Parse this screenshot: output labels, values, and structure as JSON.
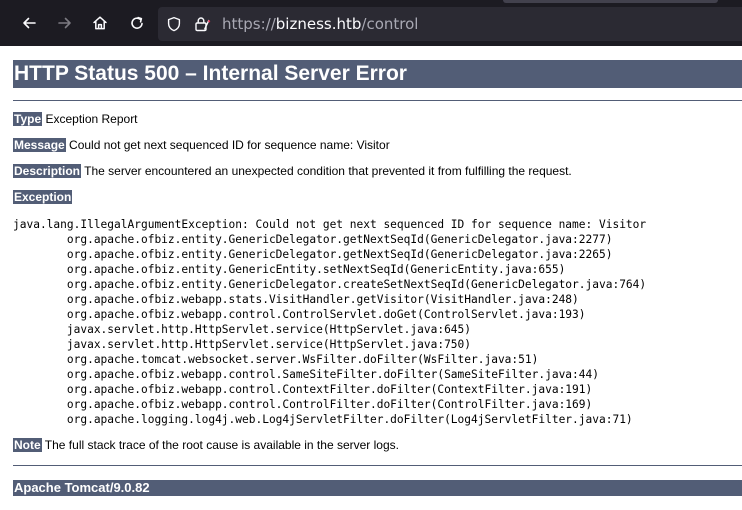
{
  "browser": {
    "url_scheme": "https://",
    "url_host": "bizness.htb",
    "url_path": "/control",
    "icons": [
      "back-arrow-icon",
      "forward-arrow-icon",
      "home-icon",
      "reload-icon",
      "shield-icon",
      "lock-icon"
    ]
  },
  "page": {
    "title": "HTTP Status 500 – Internal Server Error",
    "type_label": "Type",
    "type_value": "Exception Report",
    "message_label": "Message",
    "message_value": "Could not get next sequenced ID for sequence name: Visitor",
    "description_label": "Description",
    "description_value": "The server encountered an unexpected condition that prevented it from fulfilling the request.",
    "exception_label": "Exception",
    "stack_trace": [
      "java.lang.IllegalArgumentException: Could not get next sequenced ID for sequence name: Visitor",
      "\torg.apache.ofbiz.entity.GenericDelegator.getNextSeqId(GenericDelegator.java:2277)",
      "\torg.apache.ofbiz.entity.GenericDelegator.getNextSeqId(GenericDelegator.java:2265)",
      "\torg.apache.ofbiz.entity.GenericEntity.setNextSeqId(GenericEntity.java:655)",
      "\torg.apache.ofbiz.entity.GenericDelegator.createSetNextSeqId(GenericDelegator.java:764)",
      "\torg.apache.ofbiz.webapp.stats.VisitHandler.getVisitor(VisitHandler.java:248)",
      "\torg.apache.ofbiz.webapp.control.ControlServlet.doGet(ControlServlet.java:193)",
      "\tjavax.servlet.http.HttpServlet.service(HttpServlet.java:645)",
      "\tjavax.servlet.http.HttpServlet.service(HttpServlet.java:750)",
      "\torg.apache.tomcat.websocket.server.WsFilter.doFilter(WsFilter.java:51)",
      "\torg.apache.ofbiz.webapp.control.SameSiteFilter.doFilter(SameSiteFilter.java:44)",
      "\torg.apache.ofbiz.webapp.control.ContextFilter.doFilter(ContextFilter.java:191)",
      "\torg.apache.ofbiz.webapp.control.ControlFilter.doFilter(ControlFilter.java:169)",
      "\torg.apache.logging.log4j.web.Log4jServletFilter.doFilter(Log4jServletFilter.java:71)"
    ],
    "note_label": "Note",
    "note_value": "The full stack trace of the root cause is available in the server logs.",
    "footer": "Apache Tomcat/9.0.82"
  },
  "colors": {
    "chrome_background": "#1c1b22",
    "urlbar_background": "#2b2a33",
    "tomcat_label": "#525d76"
  }
}
